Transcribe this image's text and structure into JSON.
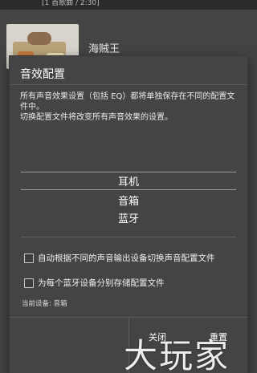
{
  "background": {
    "header_text": "[1 首歌曲 / 2:30]",
    "album_title": "海贼王"
  },
  "dialog": {
    "title": "音效配置",
    "description": [
      "所有声音效果设置（包括 EQ）都将单独保存在不同的配置文件中。",
      "切换配置文件将改变所有声音效果的设置。"
    ],
    "profiles": [
      "耳机",
      "音箱",
      "蓝牙"
    ],
    "selected_profile": "音箱",
    "options": [
      {
        "label": "自动根据不同的声音输出设备切换声音配置文件",
        "checked": false
      },
      {
        "label": "为每个蓝牙设备分别存储配置文件",
        "checked": false
      }
    ],
    "current_device": "当前设备: 音箱",
    "buttons": {
      "close": "关闭",
      "reset": "重置"
    }
  },
  "watermark": {
    "text": "大玩家"
  }
}
